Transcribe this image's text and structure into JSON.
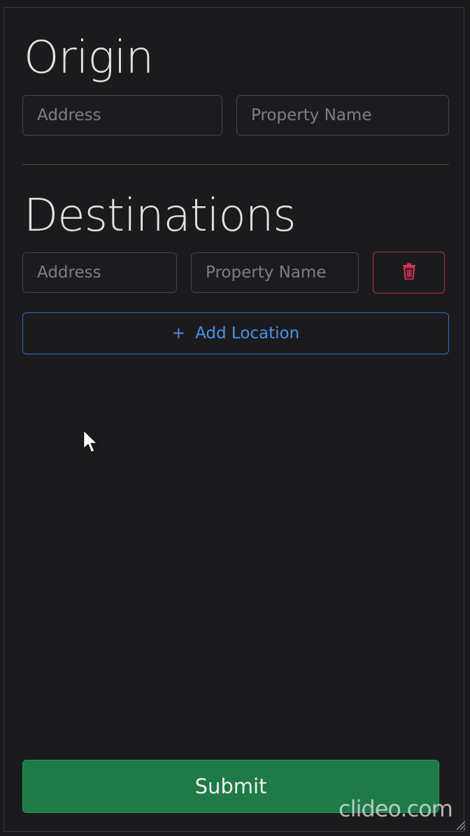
{
  "origin": {
    "title": "Origin",
    "address_placeholder": "Address",
    "property_placeholder": "Property Name"
  },
  "destinations": {
    "title": "Destinations",
    "rows": [
      {
        "address_placeholder": "Address",
        "property_placeholder": "Property Name"
      }
    ],
    "add_label": "Add Location",
    "add_icon": "+"
  },
  "submit_label": "Submit",
  "watermark": "clideo.com",
  "colors": {
    "background": "#1b1b1d",
    "danger": "#c8254a",
    "primary": "#4a90ea",
    "success": "#1e7a47"
  }
}
